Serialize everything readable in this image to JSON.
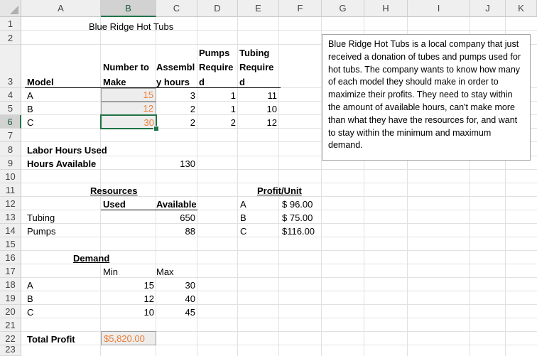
{
  "columns": [
    "A",
    "B",
    "C",
    "D",
    "E",
    "F",
    "G",
    "H",
    "I",
    "J",
    "K"
  ],
  "rows": [
    "1",
    "2",
    "3",
    "4",
    "5",
    "6",
    "7",
    "8",
    "9",
    "10",
    "11",
    "12",
    "13",
    "14",
    "15",
    "16",
    "17",
    "18",
    "19",
    "20",
    "21",
    "22",
    "23"
  ],
  "title": "Blue Ridge Hot Tubs",
  "headers": {
    "model": "Model",
    "number_to_make_1": "Number to",
    "number_to_make_2": "Make",
    "assembly_1": "Assembl",
    "assembly_2": "y hours",
    "pumps_1": "Pumps",
    "pumps_2": "Require",
    "pumps_3": "d",
    "tubing_1": "Tubing",
    "tubing_2": "Require",
    "tubing_3": "d"
  },
  "models": [
    {
      "name": "A",
      "make": "15",
      "assembly": "3",
      "pumps": "1",
      "tubing": "11"
    },
    {
      "name": "B",
      "make": "12",
      "assembly": "2",
      "pumps": "1",
      "tubing": "10"
    },
    {
      "name": "C",
      "make": "30",
      "assembly": "2",
      "pumps": "2",
      "tubing": "12"
    }
  ],
  "labor": {
    "used_label": "Labor Hours Used",
    "available_label": "Hours Available",
    "available_value": "130"
  },
  "resources": {
    "heading": "Resources",
    "used_label": "Used",
    "available_label": "Available",
    "items": [
      {
        "name": "Tubing",
        "available": "650"
      },
      {
        "name": "Pumps",
        "available": "88"
      }
    ]
  },
  "profit": {
    "heading": "Profit/Unit",
    "items": [
      {
        "model": "A",
        "value": "$ 96.00"
      },
      {
        "model": "B",
        "value": "$ 75.00"
      },
      {
        "model": "C",
        "value": "$116.00"
      }
    ]
  },
  "demand": {
    "heading": "Demand",
    "min_label": "Min",
    "max_label": "Max",
    "items": [
      {
        "model": "A",
        "min": "15",
        "max": "30"
      },
      {
        "model": "B",
        "min": "12",
        "max": "40"
      },
      {
        "model": "C",
        "min": "10",
        "max": "45"
      }
    ]
  },
  "total_profit": {
    "label": "Total Profit",
    "value": "$5,820.00"
  },
  "textbox": "Blue Ridge Hot Tubs is a local company that just received a donation of tubes and pumps used for hot tubs. The company wants to know how many of each model they should make in order to maximize their profits. They need to stay within the amount of available hours, can't make more than what they have the resources for, and want to stay within the minimum and maximum demand.",
  "colors": {
    "accent": "#217346",
    "orange": "#ed7d31",
    "gridline": "#e1e1e1",
    "header_bg": "#efefef"
  }
}
